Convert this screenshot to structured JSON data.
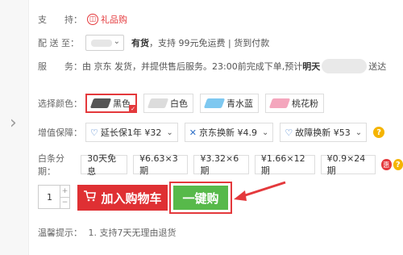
{
  "side": {
    "chevron": "›",
    "tail1": "ค",
    "tail2": "เ"
  },
  "support": {
    "label": "支　　持：",
    "gift_icon": "gift-icon",
    "gift_text": "礼品购"
  },
  "delivery": {
    "label": "配 送 至：",
    "location": "",
    "stock": "有货",
    "text": "，支持 99元免运费 | 货到付款"
  },
  "service": {
    "label": "服　　务：",
    "text_before": "由 京东 发货，并提供售后服务。23:00前完成下单,预计",
    "day": "明天",
    "text_after": "送达"
  },
  "colors": {
    "label": "选择颜色：",
    "options": [
      {
        "name": "黑色",
        "color": "#555555",
        "selected": true
      },
      {
        "name": "白色",
        "color": "#dcdcdc",
        "selected": false
      },
      {
        "name": "青水蓝",
        "color": "#7ec8f0",
        "selected": false
      },
      {
        "name": "桃花粉",
        "color": "#f4a6bd",
        "selected": false
      }
    ]
  },
  "value_add": {
    "label": "增值保障：",
    "items": [
      {
        "icon": "shield-icon",
        "glyph": "♡",
        "text": "延长保1年 ¥32"
      },
      {
        "icon": "swap-icon",
        "glyph": "✕",
        "text": "京东换新 ¥4.9"
      },
      {
        "icon": "repair-icon",
        "glyph": "♡",
        "text": "故障换新 ¥53"
      }
    ],
    "help": "?"
  },
  "installment": {
    "label": "白条分期：",
    "items": [
      "30天免息",
      "¥6.63×3期",
      "¥3.32×6期",
      "¥1.66×12期",
      "¥0.9×24期"
    ],
    "badge": "惠",
    "help": "?"
  },
  "quantity": {
    "value": "1",
    "plus": "+",
    "minus": "−"
  },
  "buttons": {
    "cart_icon": "cart-icon",
    "cart": "加入购物车",
    "buy": "一键购"
  },
  "tips": {
    "label": "温馨提示：",
    "text": "1. 支持7天无理由退货"
  },
  "accent": "#e4393c",
  "buy_color": "#57b94a"
}
